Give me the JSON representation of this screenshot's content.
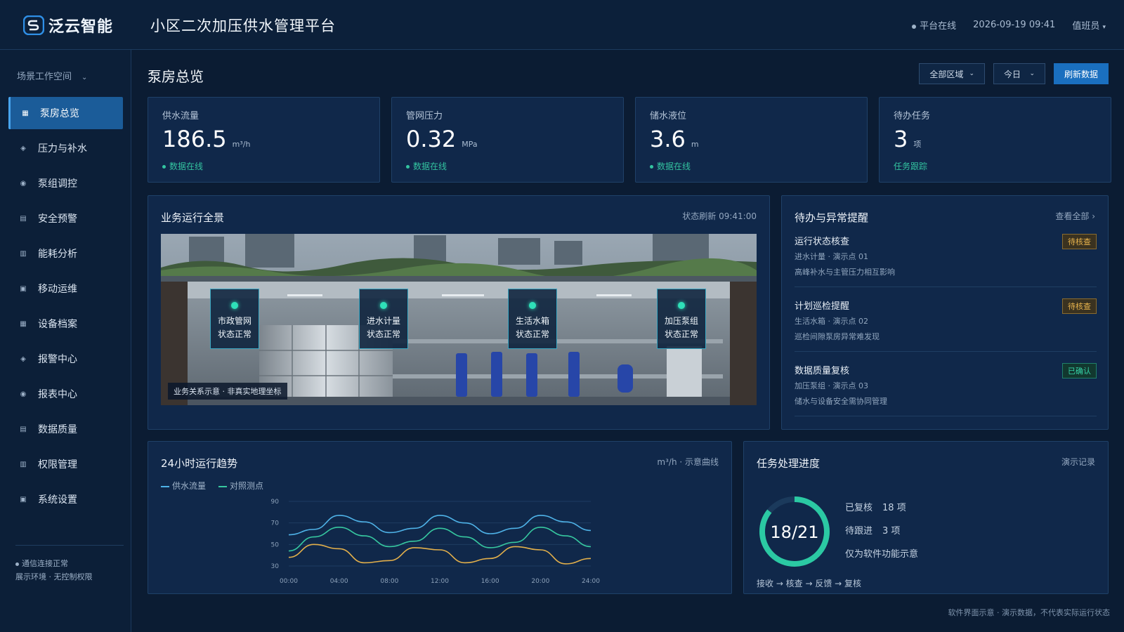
{
  "header": {
    "brand": "泛云智能",
    "title": "小区二次加压供水管理平台",
    "status": "平台在线",
    "datetime": "2026-09-19 09:41",
    "user": "值班员"
  },
  "sidebar": {
    "workspace": "场景工作空间",
    "items": [
      {
        "label": "泵房总览",
        "icon": "grid-icon"
      },
      {
        "label": "压力与补水",
        "icon": "diamond-icon"
      },
      {
        "label": "泵组调控",
        "icon": "circle-icon"
      },
      {
        "label": "安全预警",
        "icon": "list-icon"
      },
      {
        "label": "能耗分析",
        "icon": "bars-icon"
      },
      {
        "label": "移动运维",
        "icon": "square-icon"
      },
      {
        "label": "设备档案",
        "icon": "grid-icon"
      },
      {
        "label": "报警中心",
        "icon": "diamond-icon"
      },
      {
        "label": "报表中心",
        "icon": "circle-icon"
      },
      {
        "label": "数据质量",
        "icon": "list-icon"
      },
      {
        "label": "权限管理",
        "icon": "bars-icon"
      },
      {
        "label": "系统设置",
        "icon": "square-icon"
      }
    ],
    "footer_line1": "通信连接正常",
    "footer_line2": "展示环境 · 无控制权限"
  },
  "page": {
    "title": "泵房总览",
    "filter_area": "全部区域",
    "filter_date": "今日",
    "refresh": "刷新数据"
  },
  "kpis": [
    {
      "label": "供水流量",
      "value": "186.5",
      "unit": "m³/h",
      "sub": "数据在线",
      "dot": true
    },
    {
      "label": "管网压力",
      "value": "0.32",
      "unit": "MPa",
      "sub": "数据在线",
      "dot": true
    },
    {
      "label": "储水液位",
      "value": "3.6",
      "unit": "m",
      "sub": "数据在线",
      "dot": true
    },
    {
      "label": "待办任务",
      "value": "3",
      "unit": "项",
      "sub": "任务跟踪",
      "dot": false
    }
  ],
  "scene": {
    "title": "业务运行全景",
    "refresh_time": "状态刷新 09:41:00",
    "tag": "业务关系示意 · 非真实地理坐标",
    "nodes": [
      {
        "name": "市政管网",
        "status": "状态正常"
      },
      {
        "name": "进水计量",
        "status": "状态正常"
      },
      {
        "name": "生活水箱",
        "status": "状态正常"
      },
      {
        "name": "加压泵组",
        "status": "状态正常"
      }
    ]
  },
  "alerts": {
    "title": "待办与异常提醒",
    "view_all": "查看全部 ›",
    "items": [
      {
        "title": "运行状态核查",
        "line1": "进水计量 · 演示点 01",
        "line2": "高峰补水与主管压力相互影响",
        "badge": "待核查",
        "badge_type": "pending"
      },
      {
        "title": "计划巡检提醒",
        "line1": "生活水箱 · 演示点 02",
        "line2": "巡检间隙泵房异常难发现",
        "badge": "待核查",
        "badge_type": "pending"
      },
      {
        "title": "数据质量复核",
        "line1": "加压泵组 · 演示点 03",
        "line2": "储水与设备安全需协同管理",
        "badge": "已确认",
        "badge_type": "ok"
      }
    ]
  },
  "trend": {
    "title": "24小时运行趋势",
    "meta": "m³/h · 示意曲线",
    "legend": [
      "供水流量",
      "对照测点"
    ]
  },
  "chart_data": {
    "type": "line",
    "x": [
      "00:00",
      "02:00",
      "04:00",
      "06:00",
      "08:00",
      "10:00",
      "12:00",
      "14:00",
      "16:00",
      "18:00",
      "20:00",
      "22:00",
      "24:00"
    ],
    "x_ticks": [
      "00:00",
      "04:00",
      "08:00",
      "12:00",
      "16:00",
      "20:00",
      "24:00"
    ],
    "y_ticks": [
      30,
      50,
      70,
      90
    ],
    "ylim": [
      30,
      90
    ],
    "grid": true,
    "series": [
      {
        "name": "供水流量",
        "color": "#4fb3e8",
        "values": [
          59,
          64,
          77,
          71,
          61,
          65,
          77,
          70,
          60,
          65,
          77,
          71,
          63
        ]
      },
      {
        "name": "对照测点",
        "color": "#37c8a0",
        "values": [
          44,
          57,
          66,
          58,
          48,
          53,
          65,
          57,
          47,
          52,
          66,
          58,
          48
        ]
      },
      {
        "name": "",
        "color": "#e3b04b",
        "values": [
          38,
          50,
          46,
          33,
          35,
          47,
          45,
          33,
          37,
          48,
          45,
          32,
          37
        ]
      }
    ]
  },
  "progress": {
    "title": "任务处理进度",
    "meta": "演示记录",
    "done": 18,
    "total": 21,
    "ratio_text": "18/21",
    "row1_label": "已复核",
    "row1_value": "18 项",
    "row2_label": "待跟进",
    "row2_value": "3 项",
    "row3": "仅为软件功能示意",
    "flow": "接收 → 核查 → 反馈 → 复核",
    "ring_color": "#2bc9a3",
    "ring_track": "#1b3a5c"
  },
  "footer_note": "软件界面示意 · 演示数据，不代表实际运行状态"
}
